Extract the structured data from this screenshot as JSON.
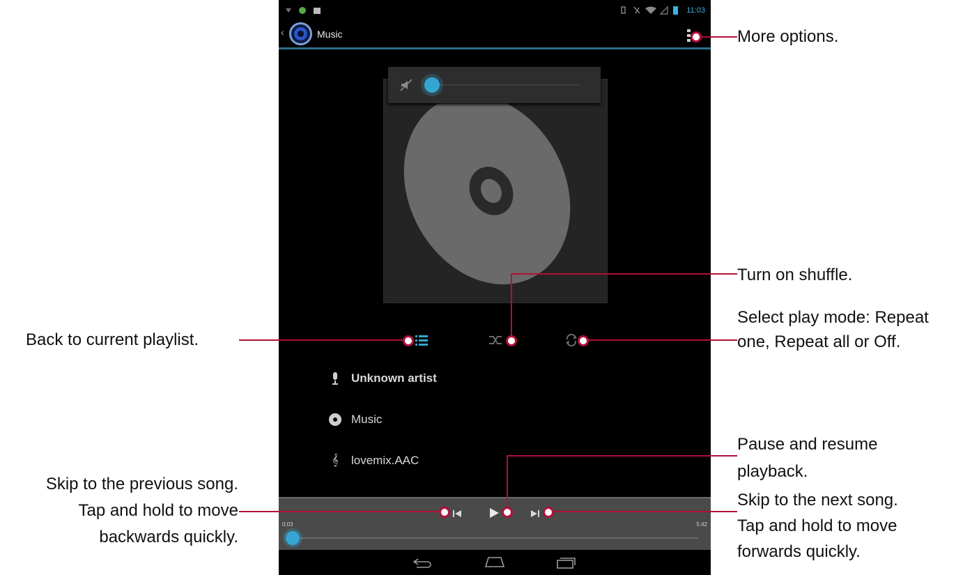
{
  "status_bar": {
    "time": "11:03"
  },
  "action_bar": {
    "back_glyph": "‹",
    "title": "Music",
    "more_icon": "overflow-menu-icon"
  },
  "album": {
    "icon": "default-album-disc"
  },
  "volume": {
    "icon": "volume-muted-icon",
    "level": 0.0
  },
  "controls": {
    "playlist_icon": "playlist-icon",
    "shuffle_icon": "shuffle-icon",
    "repeat_icon": "repeat-icon"
  },
  "track_info": {
    "artist": "Unknown artist",
    "album": "Music",
    "title": "lovemix.AAC"
  },
  "transport": {
    "elapsed": "0:03",
    "duration": "5:42",
    "progress": 0.009
  },
  "annotations": {
    "more_options": "More options.",
    "shuffle": "Turn on shuffle.",
    "play_mode_1": "Select play mode: Repeat",
    "play_mode_2": "one, Repeat all or Off.",
    "playlist": "Back to current playlist.",
    "pause_1": "Pause and resume",
    "pause_2": "playback.",
    "next_1": "Skip to the next song.",
    "next_2": "Tap and hold to move",
    "next_3": "forwards quickly.",
    "prev_1": "Skip to the previous song.",
    "prev_2": "Tap and hold to move",
    "prev_3": "backwards quickly."
  },
  "colors": {
    "accent": "#35a6d2",
    "annotation_line": "#b0103a"
  }
}
